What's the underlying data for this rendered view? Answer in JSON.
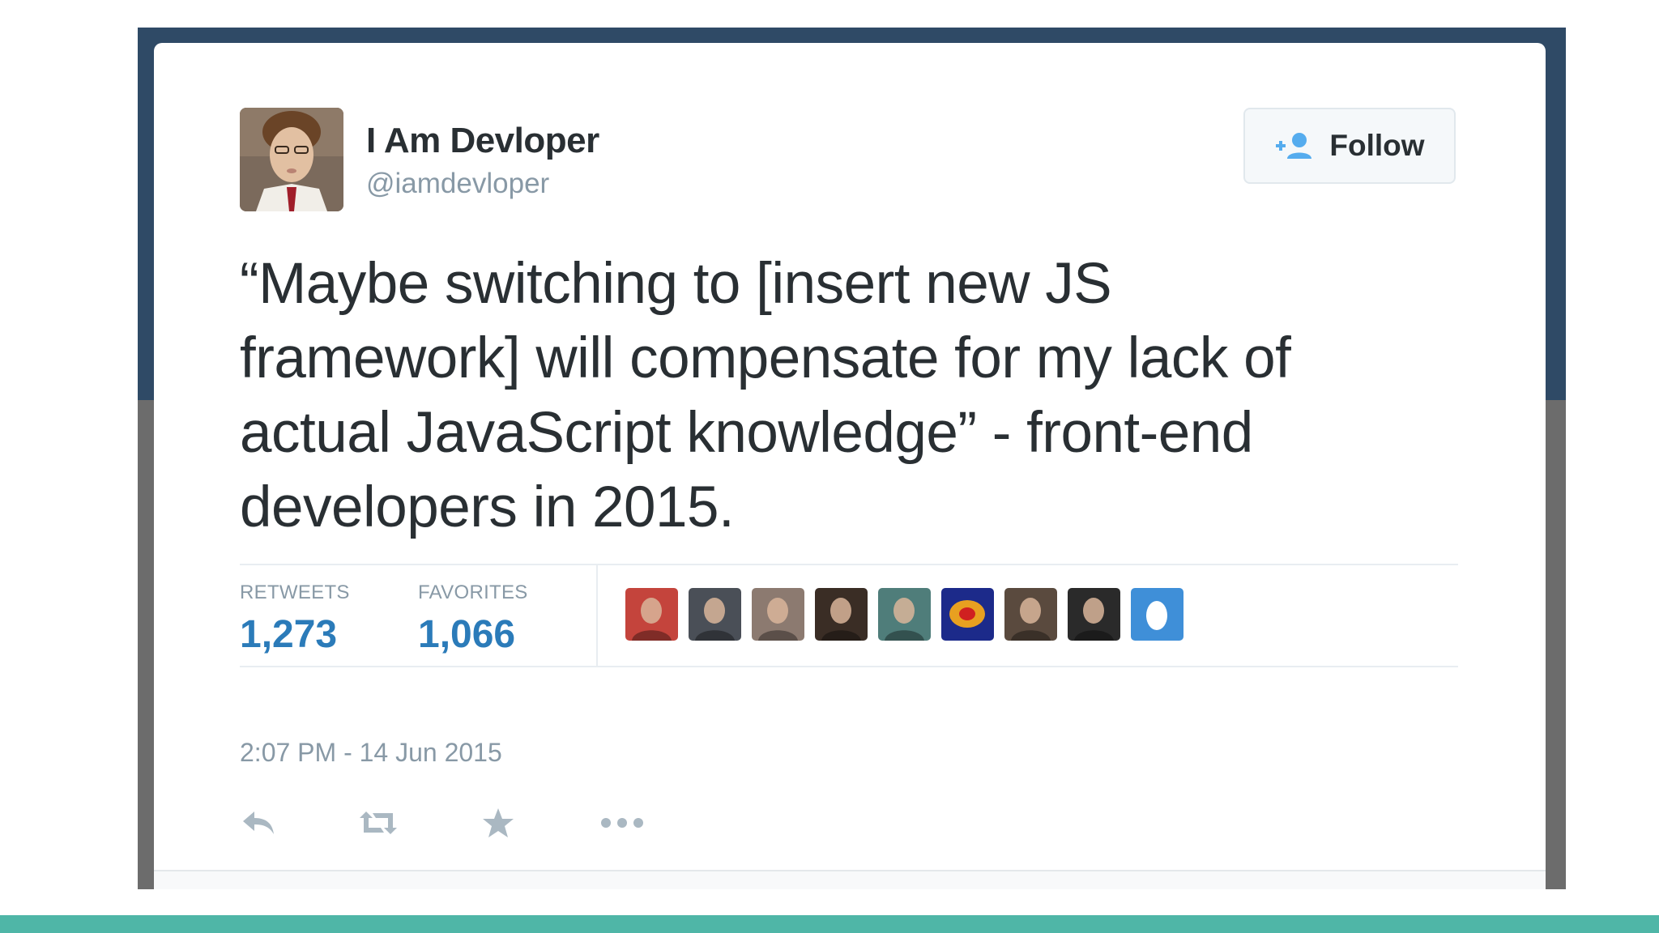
{
  "user": {
    "display_name": "I Am Devloper",
    "handle": "@iamdevloper"
  },
  "follow_button": {
    "label": "Follow",
    "icon": "add-user-icon"
  },
  "tweet": {
    "lines": [
      "“Maybe switching to [insert new JS",
      "framework] will compensate for my lack of",
      "actual JavaScript knowledge” - front-end",
      "developers in 2015."
    ]
  },
  "stats": {
    "retweets_label": "RETWEETS",
    "retweets_value": "1,273",
    "favorites_label": "FAVORITES",
    "favorites_value": "1,066"
  },
  "favoriters": [
    {
      "name": "favoriter-avatar-1",
      "color": "#c4443c"
    },
    {
      "name": "favoriter-avatar-2",
      "color": "#4a4f57"
    },
    {
      "name": "favoriter-avatar-3",
      "color": "#8c7a70"
    },
    {
      "name": "favoriter-avatar-4",
      "color": "#3a2d25"
    },
    {
      "name": "favoriter-avatar-5",
      "color": "#4f7d7a"
    },
    {
      "name": "favoriter-avatar-6",
      "color": "#1c2a8a"
    },
    {
      "name": "favoriter-avatar-7",
      "color": "#5a4a3e"
    },
    {
      "name": "favoriter-avatar-8",
      "color": "#2a2a2a"
    },
    {
      "name": "favoriter-avatar-9",
      "color": "#3f8fd8"
    }
  ],
  "timestamp": "2:07 PM - 14 Jun 2015",
  "actions": [
    {
      "icon": "reply-icon"
    },
    {
      "icon": "retweet-icon"
    },
    {
      "icon": "favorite-star-icon"
    },
    {
      "icon": "more-options-icon"
    }
  ],
  "colors": {
    "link_blue": "#2b7bb9",
    "muted_gray": "#8899a6",
    "text_dark": "#292f33",
    "backdrop_navy": "#2f4a66",
    "backdrop_gray": "#6c6c6c",
    "accent_teal": "#4fb6a7"
  }
}
